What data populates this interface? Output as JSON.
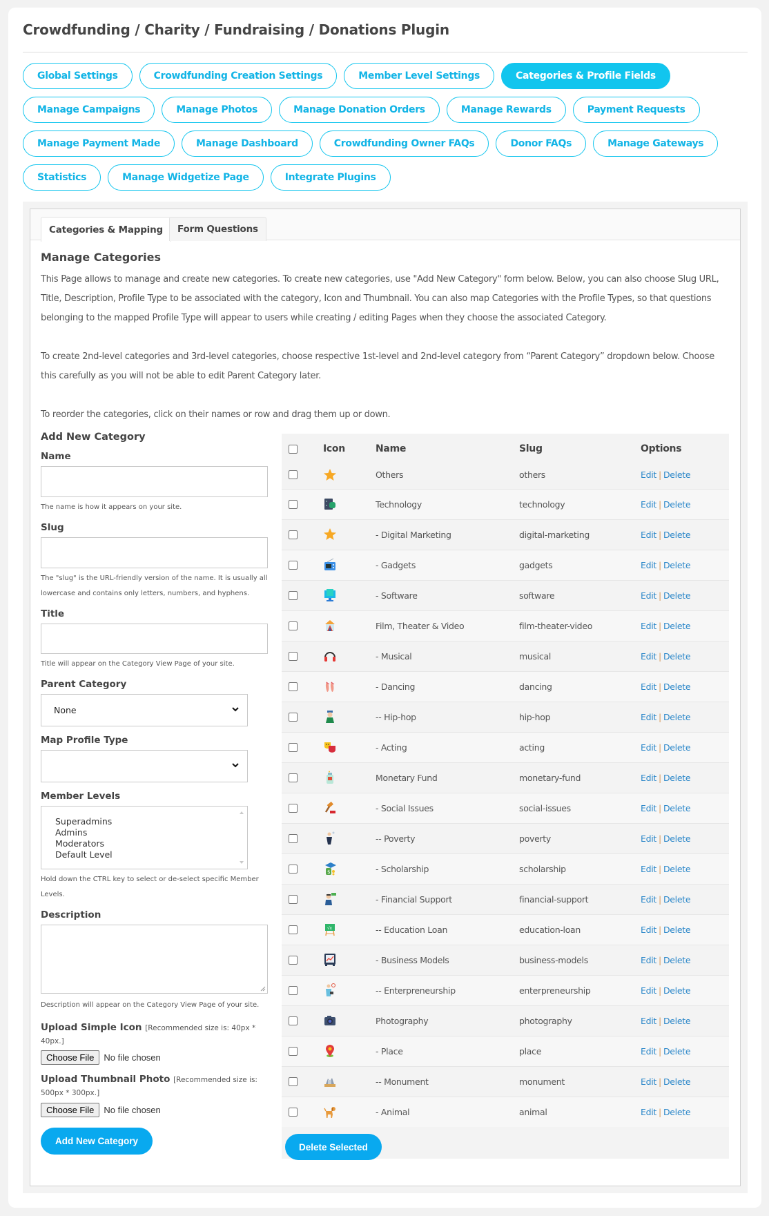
{
  "header": {
    "title": "Crowdfunding / Charity / Fundraising / Donations Plugin"
  },
  "nav": {
    "rows": [
      [
        {
          "label": "Global Settings",
          "active": false
        },
        {
          "label": "Crowdfunding Creation Settings",
          "active": false
        },
        {
          "label": "Member Level Settings",
          "active": false
        },
        {
          "label": "Categories & Profile Fields",
          "active": true
        }
      ],
      [
        {
          "label": "Manage Campaigns",
          "active": false
        },
        {
          "label": "Manage Photos",
          "active": false
        },
        {
          "label": "Manage Donation Orders",
          "active": false
        },
        {
          "label": "Manage Rewards",
          "active": false
        },
        {
          "label": "Payment Requests",
          "active": false
        }
      ],
      [
        {
          "label": "Manage Payment Made",
          "active": false
        },
        {
          "label": "Manage Dashboard",
          "active": false
        },
        {
          "label": "Crowdfunding Owner FAQs",
          "active": false
        },
        {
          "label": "Donor FAQs",
          "active": false
        },
        {
          "label": "Manage Gateways",
          "active": false
        }
      ],
      [
        {
          "label": "Statistics",
          "active": false
        },
        {
          "label": "Manage Widgetize Page",
          "active": false
        },
        {
          "label": "Integrate Plugins",
          "active": false
        }
      ]
    ],
    "accent_color": "#12c5ee"
  },
  "tabs": [
    {
      "label": "Categories & Mapping",
      "active": true
    },
    {
      "label": "Form Questions",
      "active": false
    }
  ],
  "main": {
    "title": "Manage Categories",
    "paragraphs": [
      "This Page allows to manage and create new categories. To create new categories, use \"Add New Category\" form below. Below, you can also choose Slug URL, Title, Description, Profile Type to be associated with the category, Icon and Thumbnail. You can also map Categories with the Profile Types, so that questions belonging to the mapped Profile Type will appear to users while creating / editing Pages when they choose the associated Category.",
      "To create 2nd-level categories and 3rd-level categories, choose respective 1st-level and 2nd-level category from “Parent Category” dropdown below. Choose this carefully as you will not be able to edit Parent Category later.",
      "To reorder the categories, click on their names or row and drag them up or down."
    ]
  },
  "form": {
    "heading": "Add New Category",
    "name": {
      "label": "Name",
      "value": "",
      "hint": "The name is how it appears on your site."
    },
    "slug": {
      "label": "Slug",
      "value": "",
      "hint": "The \"slug\" is the URL-friendly version of the name. It is usually all lowercase and contains only letters, numbers, and hyphens."
    },
    "title": {
      "label": "Title",
      "value": "",
      "hint": "Title will appear on the Category View Page of your site."
    },
    "parent_category": {
      "label": "Parent Category",
      "selected": "None"
    },
    "map_profile_type": {
      "label": "Map Profile Type",
      "selected": ""
    },
    "member_levels": {
      "label": "Member Levels",
      "options": [
        "Superadmins",
        "Admins",
        "Moderators",
        "Default Level"
      ],
      "hint": "Hold down the CTRL key to select or de-select specific Member Levels."
    },
    "description": {
      "label": "Description",
      "value": "",
      "hint": "Description will appear on the Category View Page of your site."
    },
    "upload_icon": {
      "label": "Upload Simple Icon",
      "note": "[Recommended size is: 40px * 40px.]",
      "button": "Choose File",
      "status": "No file chosen"
    },
    "upload_thumbnail": {
      "label": "Upload Thumbnail Photo",
      "note": "[Recommended size is: 500px * 300px.]",
      "button": "Choose File",
      "status": "No file chosen"
    },
    "submit_label": "Add New Category"
  },
  "table": {
    "columns": [
      "Icon",
      "Name",
      "Slug",
      "Options"
    ],
    "edit_label": "Edit",
    "separator": "|",
    "delete_label": "Delete",
    "rows": [
      {
        "icon": "star-icon",
        "name": "Others",
        "slug": "others"
      },
      {
        "icon": "server-icon",
        "name": "Technology",
        "slug": "technology"
      },
      {
        "icon": "star-icon",
        "name": "- Digital Marketing",
        "slug": "digital-marketing"
      },
      {
        "icon": "radio-icon",
        "name": "- Gadgets",
        "slug": "gadgets"
      },
      {
        "icon": "monitor-icon",
        "name": "- Software",
        "slug": "software"
      },
      {
        "icon": "theater-icon",
        "name": "Film, Theater & Video",
        "slug": "film-theater-video"
      },
      {
        "icon": "headphones-icon",
        "name": "- Musical",
        "slug": "musical"
      },
      {
        "icon": "ballet-shoes-icon",
        "name": "- Dancing",
        "slug": "dancing"
      },
      {
        "icon": "rapper-icon",
        "name": "-- Hip-hop",
        "slug": "hip-hop"
      },
      {
        "icon": "theater-masks-icon",
        "name": "- Acting",
        "slug": "acting"
      },
      {
        "icon": "money-jar-icon",
        "name": "Monetary Fund",
        "slug": "monetary-fund"
      },
      {
        "icon": "gavel-icon",
        "name": "- Social Issues",
        "slug": "social-issues"
      },
      {
        "icon": "person-icon",
        "name": "-- Poverty",
        "slug": "poverty"
      },
      {
        "icon": "graduation-money-icon",
        "name": "- Scholarship",
        "slug": "scholarship"
      },
      {
        "icon": "advisor-icon",
        "name": "- Financial Support",
        "slug": "financial-support"
      },
      {
        "icon": "chalkboard-icon",
        "name": "-- Education Loan",
        "slug": "education-loan"
      },
      {
        "icon": "presentation-board-icon",
        "name": "- Business Models",
        "slug": "business-models"
      },
      {
        "icon": "businessman-icon",
        "name": "-- Enterpreneurship",
        "slug": "enterpreneurship"
      },
      {
        "icon": "camera-icon",
        "name": "Photography",
        "slug": "photography"
      },
      {
        "icon": "map-pin-icon",
        "name": "- Place",
        "slug": "place"
      },
      {
        "icon": "monument-icon",
        "name": "-- Monument",
        "slug": "monument"
      },
      {
        "icon": "dog-icon",
        "name": "- Animal",
        "slug": "animal"
      }
    ],
    "delete_selected_label": "Delete Selected"
  }
}
